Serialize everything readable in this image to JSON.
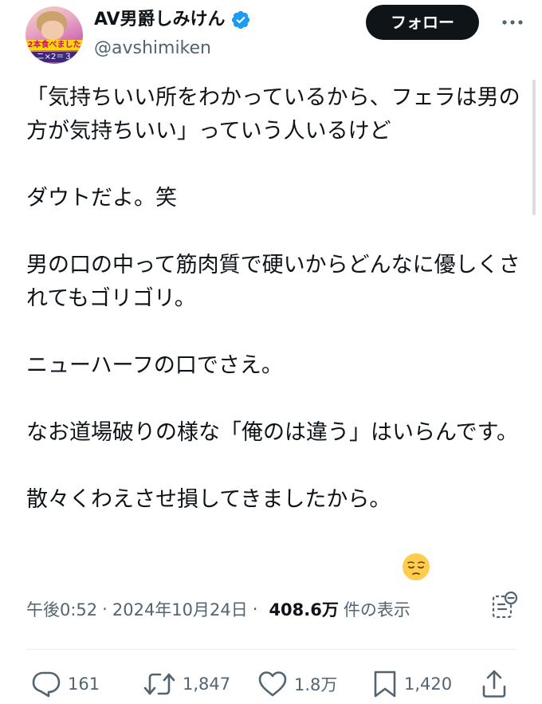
{
  "author": {
    "display_name": "AV男爵しみけん",
    "handle": "@avshimiken",
    "avatar_caption": "2本食べました",
    "avatar_caption2": "ニ×2＝３"
  },
  "header": {
    "follow_label": "フォロー"
  },
  "tweet": {
    "paragraphs": [
      "「気持ちいい所をわかっているから、フェラは男の方が気持ちいい」っていう人いるけど",
      "ダウトだよ。笑",
      "男の口の中って筋肉質で硬いからどんなに優しくされてもゴリゴリ。",
      "ニューハーフの口でさえ。",
      "なお道場破りの様な「俺のは違う」はいらんです。",
      "散々くわえさせ損してきましたから。"
    ],
    "emoji": "pensive-face"
  },
  "meta": {
    "time": "午後0:52",
    "separator": "·",
    "date": "2024年10月24日",
    "views_count": "408.6万",
    "views_label": "件の表示"
  },
  "actions": {
    "reply_count": "161",
    "retweet_count": "1,847",
    "like_count": "1.8万",
    "bookmark_count": "1,420"
  },
  "colors": {
    "text": "#0f1419",
    "secondary": "#536471",
    "verified": "#1d9bf0",
    "follow_bg": "#0f1419",
    "emoji": "#ffcc4d"
  },
  "icons": {
    "verified": "verified-badge-icon",
    "more": "more-dots-icon",
    "analytics": "analytics-icon",
    "reply": "reply-icon",
    "retweet": "retweet-icon",
    "like": "heart-icon",
    "bookmark": "bookmark-icon",
    "share": "share-icon"
  }
}
